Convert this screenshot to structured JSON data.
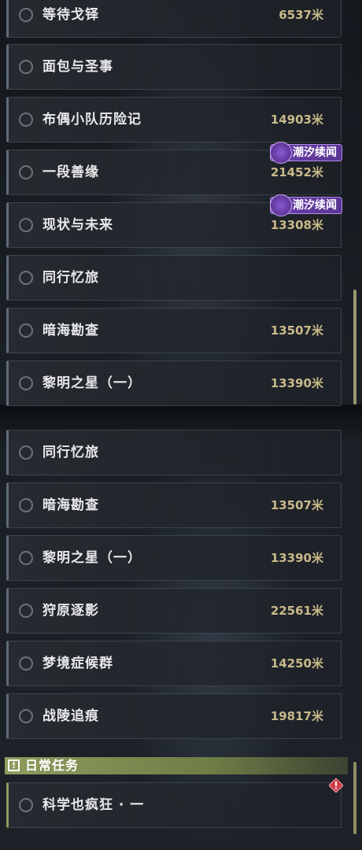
{
  "upper_list": [
    {
      "name": "等待戈铎",
      "distance": "6537米",
      "tag": ""
    },
    {
      "name": "面包与圣事",
      "distance": "",
      "tag": ""
    },
    {
      "name": "布偶小队历险记",
      "distance": "14903米",
      "tag": ""
    },
    {
      "name": "一段善缘",
      "distance": "21452米",
      "tag": "潮汐续闻"
    },
    {
      "name": "现状与未来",
      "distance": "13308米",
      "tag": "潮汐续闻"
    },
    {
      "name": "同行忆旅",
      "distance": "",
      "tag": ""
    },
    {
      "name": "暗海勘查",
      "distance": "13507米",
      "tag": ""
    },
    {
      "name": "黎明之星（一）",
      "distance": "13390米",
      "tag": ""
    }
  ],
  "lower_list": [
    {
      "name": "同行忆旅",
      "distance": "",
      "tag": ""
    },
    {
      "name": "暗海勘查",
      "distance": "13507米",
      "tag": ""
    },
    {
      "name": "黎明之星（一）",
      "distance": "13390米",
      "tag": ""
    },
    {
      "name": "狩原逐影",
      "distance": "22561米",
      "tag": ""
    },
    {
      "name": "梦境症候群",
      "distance": "14250米",
      "tag": ""
    },
    {
      "name": "战陵追痕",
      "distance": "19817米",
      "tag": ""
    }
  ],
  "daily_section": {
    "title": "日常任务",
    "icon": "exclamation-icon",
    "items": [
      {
        "name": "科学也疯狂 · 一",
        "distance": "",
        "alert_icon": "alert-diamond-icon"
      }
    ]
  },
  "colors": {
    "tag_purple": "#6b3ea8",
    "distance_gold": "#c9b98a",
    "section_green": "#8e9b5e",
    "alert_red": "#d23c4a"
  }
}
